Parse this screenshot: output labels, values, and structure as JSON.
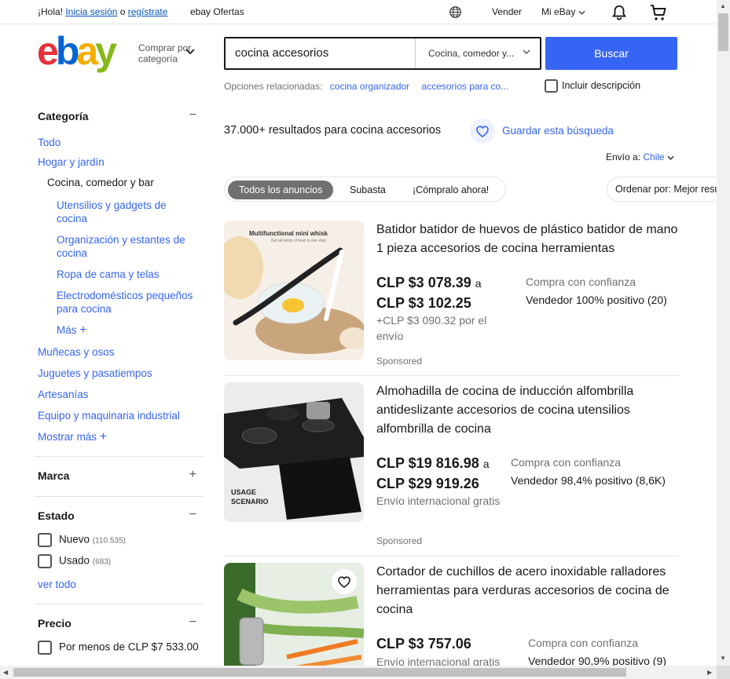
{
  "topbar": {
    "greeting": "¡Hola! ",
    "signin": "Inicia sesión",
    "or": " o ",
    "register": "regístrate",
    "deals": "ebay Ofertas",
    "sell": "Vender",
    "myebay": "Mi eBay"
  },
  "header": {
    "shop_by_category": "Comprar por categoría",
    "search_query": "cocina accesorios",
    "category_select": "Cocina, comedor y...",
    "search_button": "Buscar",
    "related_label": "Opciones relacionadas:",
    "related": [
      "cocina organizador",
      "accesorios para co..."
    ],
    "include_description": "Incluir descripción"
  },
  "sidebar": {
    "category_heading": "Categoría",
    "all": "Todo",
    "parent": "Hogar y jardín",
    "current": "Cocina, comedor y bar",
    "subcategories": [
      "Utensilios y gadgets de cocina",
      "Organización y estantes de cocina",
      "Ropa de cama y telas",
      "Electrodomésticos pequeños para cocina"
    ],
    "more": "Más",
    "siblings": [
      "Muñecas y osos",
      "Juguetes y pasatiempos",
      "Artesanías",
      "Equipo y maquinaria industrial"
    ],
    "show_more": "Mostrar más",
    "brand_heading": "Marca",
    "condition_heading": "Estado",
    "conditions": [
      {
        "label": "Nuevo",
        "count": "(110.535)"
      },
      {
        "label": "Usado",
        "count": "(683)"
      }
    ],
    "see_all": "ver todo",
    "price_heading": "Precio",
    "price_option": "Por menos de CLP $7 533.00"
  },
  "results": {
    "count": "37.000+",
    "count_text": " resultados para ",
    "query": "cocina accesorios",
    "save_search": "Guardar esta búsqueda",
    "ship_to_label": "Envío a:",
    "ship_to_value": "Chile",
    "tabs": [
      "Todos los anuncios",
      "Subasta",
      "¡Cómpralo ahora!"
    ],
    "sort": "Ordenar por: Mejor resultado"
  },
  "items": [
    {
      "title": "Batidor batidor de huevos de plástico batidor de mano 1 pieza accesorios de cocina herramientas",
      "price_low": "CLP $3 078.39",
      "a": "a",
      "price_high": "CLP $3 102.25",
      "shipping": "+CLP $3 090.32 por el envío",
      "trust": "Compra con confianza",
      "seller": "Vendedor 100% positivo (20)",
      "sponsored": "Sponsored",
      "image_caption": "Multifunctional mini whisk",
      "image_subcaption": "Get all kinds of food in one step"
    },
    {
      "title": "Almohadilla de cocina de inducción alfombrilla antideslizante accesorios de cocina utensilios alfombrilla de cocina",
      "price_low": "CLP $19 816.98",
      "a": "a",
      "price_high": "CLP $29 919.26",
      "shipping": "Envío internacional gratis",
      "trust": "Compra con confianza",
      "seller": "Vendedor 98,4% positivo (8,6K)",
      "sponsored": "Sponsored",
      "image_caption": "USAGE SCENARIO"
    },
    {
      "title": "Cortador de cuchillos de acero inoxidable ralladores herramientas para verduras accesorios de cocina de cocina",
      "price": "CLP $3 757.06",
      "shipping": "Envío internacional gratis",
      "trust": "Compra con confianza",
      "seller": "Vendedor 90,9% positivo (9)"
    }
  ],
  "colors": {
    "link": "#3665f3",
    "button": "#3665f3",
    "text": "#191919",
    "muted": "#707070"
  }
}
